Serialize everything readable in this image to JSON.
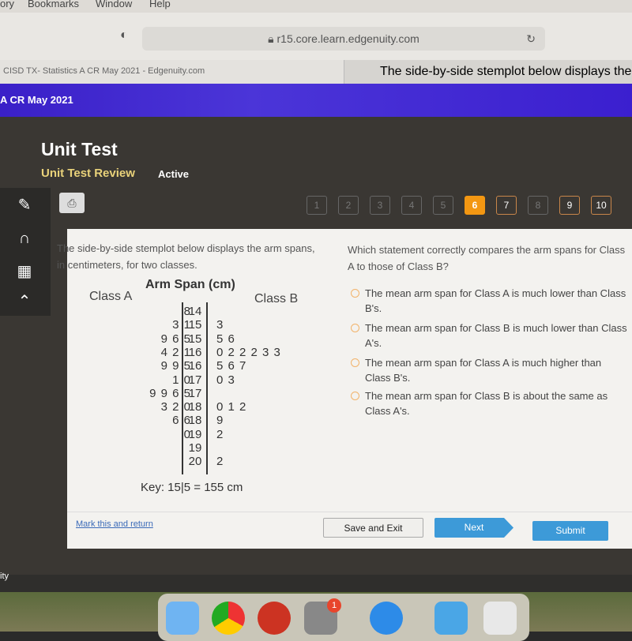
{
  "menubar": {
    "items": [
      "ory",
      "Bookmarks",
      "Window",
      "Help"
    ]
  },
  "browser": {
    "url": "r15.core.learn.edgenuity.com",
    "tabs": [
      "CISD TX- Statistics A CR May 2021 - Edgenuity.com",
      "The side-by-side stemplot below displays the arm spans, in ce"
    ]
  },
  "banner": {
    "course": "A CR May 2021"
  },
  "header": {
    "title": "Unit Test",
    "subtitle": "Unit Test Review",
    "status": "Active"
  },
  "nav": {
    "questions": [
      "1",
      "2",
      "3",
      "4",
      "5",
      "6",
      "7",
      "8",
      "9",
      "10"
    ],
    "current": "6",
    "answered": [
      "7",
      "9",
      "10"
    ]
  },
  "question": {
    "prompt": "The side-by-side stemplot below displays the arm spans, in centimeters, for two classes.",
    "stem": "Which statement correctly compares the arm spans for Class A to those of Class B?",
    "options": [
      "The mean arm span for Class A is much lower than Class B's.",
      "The mean arm span for Class B is much lower than Class A's.",
      "The mean arm span for Class A is much higher than Class B's.",
      "The mean arm span for Class B is about the same as Class A's."
    ]
  },
  "stemplot": {
    "title": "Arm Span (cm)",
    "left_label": "Class A",
    "right_label": "Class B",
    "key": "Key: 15|5 = 155 cm",
    "rows": [
      {
        "left": "8",
        "stem": "14",
        "right": ""
      },
      {
        "left": "3 1",
        "stem": "15",
        "right": "3"
      },
      {
        "left": "9 6 5",
        "stem": "15",
        "right": "5 6"
      },
      {
        "left": "4 2 1",
        "stem": "16",
        "right": "0 2 2 2 3 3"
      },
      {
        "left": "9 9 5",
        "stem": "16",
        "right": "5 6 7"
      },
      {
        "left": "1 0",
        "stem": "17",
        "right": "0 3"
      },
      {
        "left": "9 9 6 5",
        "stem": "17",
        "right": ""
      },
      {
        "left": "3 2 0",
        "stem": "18",
        "right": "0 1 2"
      },
      {
        "left": "6 6",
        "stem": "18",
        "right": "9"
      },
      {
        "left": "0",
        "stem": "19",
        "right": "2"
      },
      {
        "left": "",
        "stem": "19",
        "right": ""
      },
      {
        "left": "",
        "stem": "20",
        "right": "2"
      }
    ]
  },
  "footer": {
    "mark": "Mark this and return",
    "save": "Save and Exit",
    "next": "Next",
    "submit": "Submit"
  },
  "desktop": {
    "partial_label": "ity",
    "badge": "1"
  },
  "colors": {
    "accent": "#f39712",
    "banner": "#3a20c8",
    "button": "#3d9ad8"
  }
}
